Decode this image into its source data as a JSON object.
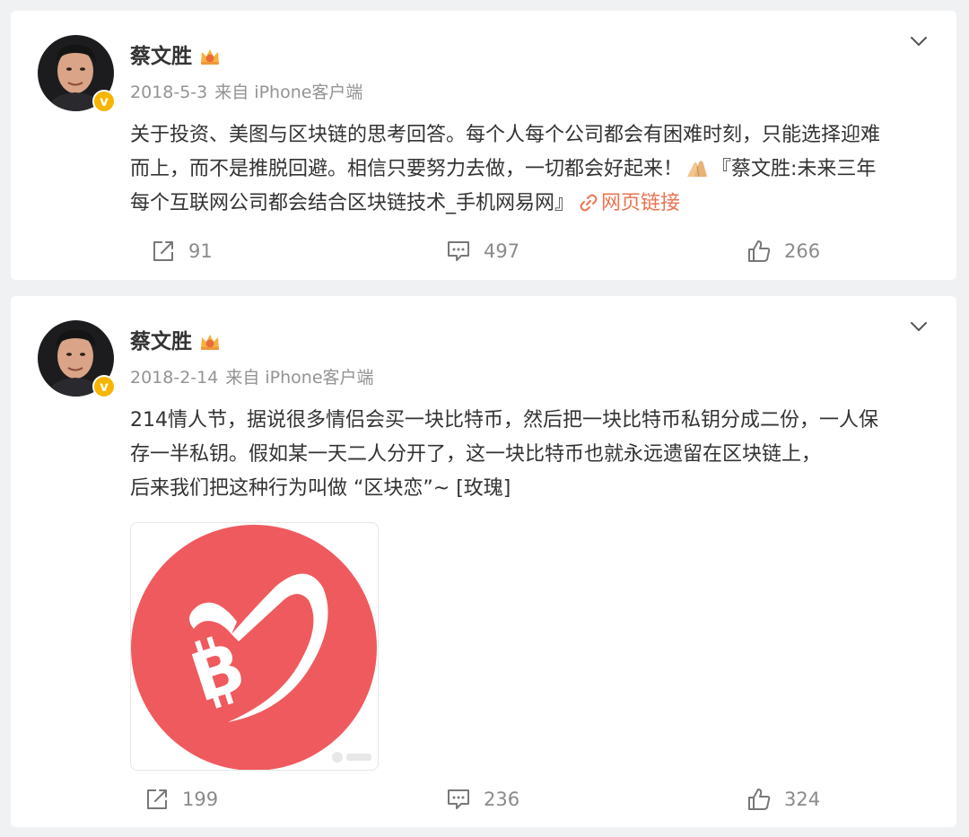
{
  "posts": [
    {
      "author": "蔡文胜",
      "date": "2018-5-3",
      "source": "来自 iPhone客户端",
      "text_lines": [
        "关于投资、美图与区块链的思考回答。每个人每个公司都会有困难时刻，只能选择迎难",
        "而上，而不是推脱回避。相信只要努力去做，一切都会好起来！",
        "『蔡文胜:未来三年",
        "每个互联网公司都会结合区块链技术_手机网易网』"
      ],
      "link_label": "网页链接",
      "reposts": "91",
      "comments": "497",
      "likes": "266"
    },
    {
      "author": "蔡文胜",
      "date": "2018-2-14",
      "source": "来自 iPhone客户端",
      "text_lines": [
        "214情人节，据说很多情侣会买一块比特币，然后把一块比特币私钥分成二份，一人保",
        "存一半私钥。假如某一天二人分开了，这一块比特币也就永远遗留在区块链上，",
        "后来我们把这种行为叫做 “区块恋”~ [玫瑰]"
      ],
      "image_icon": "bitcoin-heart-icon",
      "reposts": "199",
      "comments": "236",
      "likes": "324"
    }
  ],
  "colors": {
    "link": "#eb7350",
    "verified": "#f7b500",
    "image_red": "#ef5a5e"
  }
}
